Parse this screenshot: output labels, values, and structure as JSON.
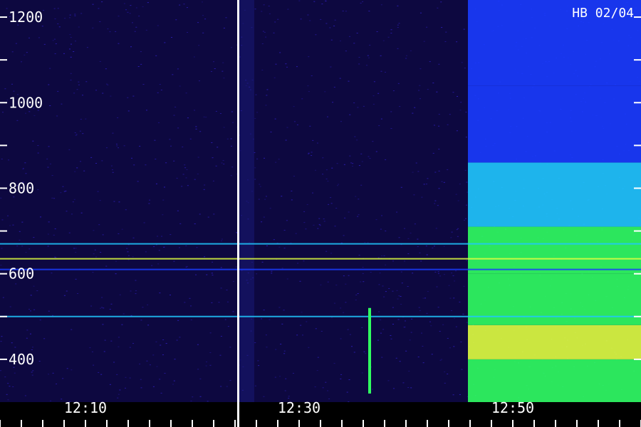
{
  "chart_data": {
    "type": "heatmap",
    "title": "",
    "corner_label": "HB 02/04",
    "xlabel": "",
    "ylabel": "",
    "x_axis": {
      "unit": "time",
      "labels": [
        {
          "text": "12:10",
          "minutes": 10
        },
        {
          "text": "12:30",
          "minutes": 30
        },
        {
          "text": "12:50",
          "minutes": 50
        }
      ],
      "range_minutes": [
        2,
        62
      ]
    },
    "y_axis": {
      "labels": [
        {
          "text": "400",
          "value": 400
        },
        {
          "text": "600",
          "value": 600
        },
        {
          "text": "800",
          "value": 800
        },
        {
          "text": "1000",
          "value": 1000
        },
        {
          "text": "1200",
          "value": 1200
        }
      ],
      "range": [
        300,
        1240
      ],
      "minor_tick_step": 100
    },
    "marker_line_minutes": 24.3,
    "dim_segment_minutes": [
      24.3,
      25.8
    ],
    "narrowband_lines": [
      {
        "value": 670,
        "intensity": 0.55
      },
      {
        "value": 635,
        "intensity": 0.85
      },
      {
        "value": 610,
        "intensity": 0.35
      },
      {
        "value": 500,
        "intensity": 0.45
      }
    ],
    "vertical_burst": {
      "minutes": 36.6,
      "from": 320,
      "to": 520,
      "intensity": 0.8
    },
    "emission_region": {
      "start_minutes": 45.8,
      "bands": [
        {
          "from": 300,
          "to": 400,
          "intensity": 0.75
        },
        {
          "from": 400,
          "to": 480,
          "intensity": 0.85
        },
        {
          "from": 480,
          "to": 600,
          "intensity": 0.7
        },
        {
          "from": 600,
          "to": 710,
          "intensity": 0.65
        },
        {
          "from": 710,
          "to": 860,
          "intensity": 0.45
        },
        {
          "from": 860,
          "to": 1040,
          "intensity": 0.3
        },
        {
          "from": 1040,
          "to": 1240,
          "intensity": 0.22
        }
      ]
    },
    "colors": {
      "background": "#0d0840",
      "noise": "#3322cc",
      "low": "#1a3cff",
      "mid": "#20c8ff",
      "high": "#30ff60",
      "peak": "#e0ff40",
      "marker": "#ffffff"
    }
  }
}
